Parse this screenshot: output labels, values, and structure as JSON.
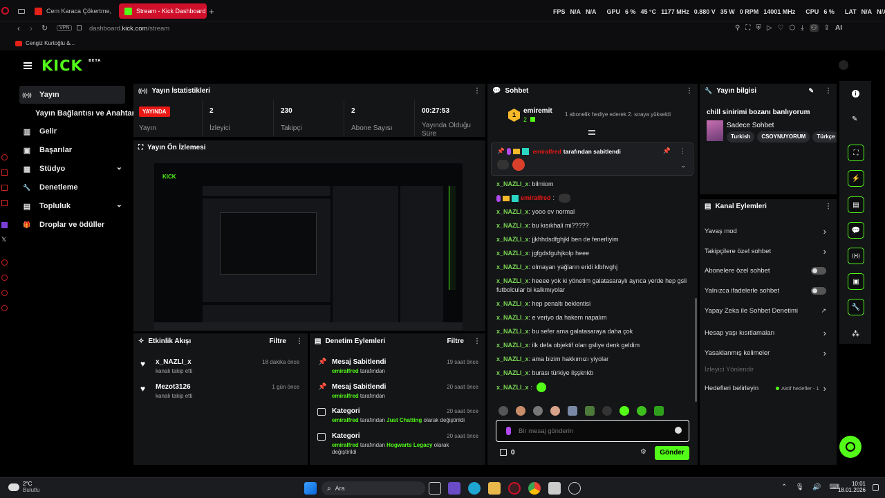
{
  "browser": {
    "tabs": [
      {
        "label": "Cem Karaca Çökertme, Ce"
      },
      {
        "label": "Stream - Kick Dashboard"
      }
    ],
    "url": {
      "prefix": "dashboard.",
      "domain": "kick.com",
      "path": "/stream"
    },
    "vpn_label": "VPN",
    "bookmark": "Cengiz Kurtoğlu &...",
    "ai_label": "AI"
  },
  "overlay": {
    "fps_label": "FPS",
    "fps_v1": "N/A",
    "fps_v2": "N/A",
    "gpu_label": "GPU",
    "gpu_load": "6 %",
    "gpu_temp": "45 °C",
    "gpu_clock": "1177 MHz",
    "gpu_volt": "0.880 V",
    "gpu_power": "35 W",
    "gpu_fan": "0 RPM",
    "gpu_mem": "14001 MHz",
    "cpu_label": "CPU",
    "cpu_load": "6 %",
    "lat_label": "LAT",
    "lat_v1": "N/A",
    "lat_v2": "N/A"
  },
  "kick": {
    "logo": "KICK",
    "beta": "BETA"
  },
  "sidebar": {
    "items": [
      {
        "label": "Yayın",
        "icon": "broadcast-icon",
        "glyph": "((•))"
      },
      {
        "label": "Yayın Bağlantısı ve Anahtarı",
        "icon": "none",
        "glyph": ""
      },
      {
        "label": "Gelir",
        "icon": "chart-icon",
        "glyph": "▥"
      },
      {
        "label": "Başarılar",
        "icon": "trophy-icon",
        "glyph": "▣"
      },
      {
        "label": "Stüdyo",
        "icon": "studio-icon",
        "glyph": "▦",
        "chevron": "⌄"
      },
      {
        "label": "Denetleme",
        "icon": "wrench-icon",
        "glyph": "🔧"
      },
      {
        "label": "Topluluk",
        "icon": "community-icon",
        "glyph": "▤",
        "chevron": "⌄"
      },
      {
        "label": "Droplar ve ödüller",
        "icon": "gift-icon",
        "glyph": "🎁"
      }
    ]
  },
  "stats": {
    "title": "Yayın İstatistikleri",
    "live_badge": "YAYINDA",
    "live_label": "Yayın",
    "viewers": "2",
    "viewers_label": "İzleyici",
    "followers": "230",
    "followers_label": "Takipçi",
    "subs": "2",
    "subs_label": "Abone Sayısı",
    "uptime": "00:27:53",
    "uptime_label": "Yayında Olduğu Süre"
  },
  "preview": {
    "title": "Yayın Ön İzlemesi"
  },
  "activity": {
    "title": "Etkinlik Akışı",
    "filter": "Filtre",
    "items": [
      {
        "user": "x_NAZLI_x",
        "desc": "kanalı takip etti",
        "time": "18 dakika önce"
      },
      {
        "user": "Mezot3126",
        "desc": "kanalı takip etti",
        "time": "1 gün önce"
      }
    ]
  },
  "moderation": {
    "title": "Denetim Eylemleri",
    "filter": "Filtre",
    "items": [
      {
        "title": "Mesaj Sabitlendi",
        "user": "emiralfred",
        "rest": " tarafından",
        "extra": "",
        "tail": "",
        "time": "19 saat önce"
      },
      {
        "title": "Mesaj Sabitlendi",
        "user": "emiralfred",
        "rest": " tarafından",
        "extra": "",
        "tail": "",
        "time": "20 saat önce"
      },
      {
        "title": "Kategori",
        "user": "emiralfred",
        "rest": " tarafından ",
        "extra": "Just Chatting",
        "tail": " olarak değiştirildi",
        "time": "20 saat önce"
      },
      {
        "title": "Kategori",
        "user": "emiralfred",
        "rest": " tarafından ",
        "extra": "Hogwarts Legacy",
        "tail": " olarak değiştirildi",
        "time": "20 saat önce"
      }
    ]
  },
  "chat": {
    "title": "Sohbet",
    "top_user": "emiremit",
    "top_count": "2",
    "top_msg": "1 abonelik hediye ederek 2. sıraya yükseldi",
    "pinned_user": "emiralfred",
    "pinned_text": "tarafından sabitlendi",
    "messages": [
      {
        "user": "x_NAZLI_x",
        "text": "bilmiom"
      },
      {
        "user": "emiralfred",
        "text": ""
      },
      {
        "user": "x_NAZLI_x",
        "text": "yooo ev normal"
      },
      {
        "user": "x_NAZLI_x",
        "text": "bu kısıkhali mi?????"
      },
      {
        "user": "x_NAZLI_x",
        "text": "jjkhhdsdfghjkl ben de fenerliyim"
      },
      {
        "user": "x_NAZLI_x",
        "text": "jgfgdsfguhjkolp heee"
      },
      {
        "user": "x_NAZLI_x",
        "text": "olmayan yağların eridi klbhvghj"
      },
      {
        "user": "x_NAZLI_x",
        "text": "heeee yok ki yönetim galatasaraylı ayrıca yerde hep gsli futbolcular bi kalkmıyolar"
      },
      {
        "user": "x_NAZLI_x",
        "text": "hep penaltı beklentisi"
      },
      {
        "user": "x_NAZLI_x",
        "text": "e veriyo da hakem napalım"
      },
      {
        "user": "x_NAZLI_x",
        "text": "bu sefer ama galatasaraya daha çok"
      },
      {
        "user": "x_NAZLI_x",
        "text": "ilk defa objektif olan gsliye denk geldim"
      },
      {
        "user": "x_NAZLI_x",
        "text": "ama bizim hakkımızı yiyolar"
      },
      {
        "user": "x_NAZLI_x",
        "text": "burası türkiye ilşşknkb"
      },
      {
        "user": "x_NAZLI_x",
        "text": ""
      }
    ],
    "placeholder": "Bir mesaj gönderin",
    "count": "0",
    "send": "Gönder"
  },
  "stream_info": {
    "title": "Yayın bilgisi",
    "stream_title": "chill sinirimi bozanı banlıyorum",
    "category": "Sadece Sohbet",
    "tags": [
      "Turkish",
      "CSOYNUYORUM",
      "Türkçe"
    ]
  },
  "channel_actions": {
    "title": "Kanal Eylemleri",
    "items": [
      {
        "label": "Yavaş mod",
        "kind": "chevron"
      },
      {
        "label": "Takipçilere özel sohbet",
        "kind": "chevron"
      },
      {
        "label": "Abonelere özel sohbet",
        "kind": "toggle"
      },
      {
        "label": "Yalnızca ifadelerle sohbet",
        "kind": "toggle"
      },
      {
        "label": "Yapay Zeka ile Sohbet Denetimi",
        "kind": "external"
      },
      {
        "label": "Hesap yaşı kısıtlamaları",
        "kind": "chevron"
      },
      {
        "label": "Yasaklanmış kelimeler",
        "kind": "chevron"
      }
    ],
    "section": "İzleyici Yönlendir",
    "goals_label": "Hedefleri belirleyin",
    "goals_status": "Aktif hedefler - 1"
  },
  "taskbar": {
    "weather_temp": "2°C",
    "weather_desc": "Bulutlu",
    "search": "Ara",
    "time": "10:01",
    "date": "18.01.2026"
  },
  "colors": {
    "accent": "#53fc18",
    "live": "#e91916",
    "panel": "#141517"
  }
}
